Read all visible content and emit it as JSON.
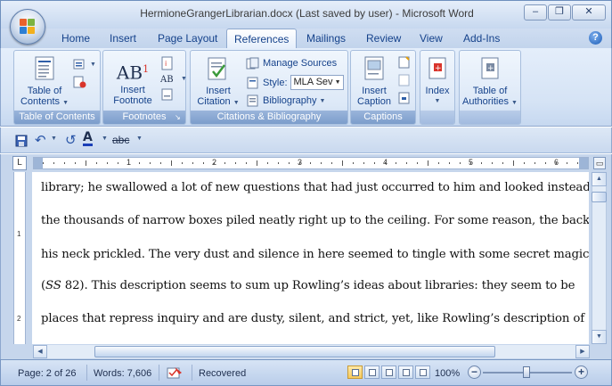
{
  "window": {
    "title": "HermioneGrangerLibrarian.docx (Last saved by user) - Microsoft Word",
    "controls": [
      "–",
      "❐",
      "✕"
    ]
  },
  "tabs": [
    {
      "label": "Home"
    },
    {
      "label": "Insert"
    },
    {
      "label": "Page Layout"
    },
    {
      "label": "References",
      "active": true
    },
    {
      "label": "Mailings"
    },
    {
      "label": "Review"
    },
    {
      "label": "View"
    },
    {
      "label": "Add-Ins"
    }
  ],
  "ribbon": {
    "toc_group": {
      "label": "Table of Contents",
      "button": [
        "Table of",
        "Contents"
      ]
    },
    "footnotes_group": {
      "label": "Footnotes",
      "button": [
        "Insert",
        "Footnote"
      ],
      "icon_text": "AB",
      "icon_sup": "1"
    },
    "citations_group": {
      "label": "Citations & Bibliography",
      "insert_citation": [
        "Insert",
        "Citation"
      ],
      "manage_sources": "Manage Sources",
      "style_label": "Style:",
      "style_value": "MLA Sev",
      "bibliography": "Bibliography"
    },
    "captions_group": {
      "label": "Captions",
      "button": [
        "Insert",
        "Caption"
      ]
    },
    "index_group": {
      "button": "Index"
    },
    "authorities_group": {
      "button": [
        "Table of",
        "Authorities"
      ]
    }
  },
  "qat": {
    "strike_label": "abc"
  },
  "ruler": {
    "numbers": [
      "1",
      "2",
      "3",
      "4",
      "5",
      "6"
    ]
  },
  "vruler": {
    "numbers": [
      "1",
      "2"
    ]
  },
  "document": {
    "lines": [
      "library; he swallowed a lot of new questions that had just occurred to him and looked instead at",
      "the thousands of narrow boxes piled neatly right up to the ceiling.  For some reason, the back of",
      "his neck prickled. The very dust and silence in here seemed to tingle with some secret magic”",
      "(SS 82).  This description seems to sum up Rowling’s ideas about libraries:  they seem to be",
      "places that repress inquiry and are dusty, silent, and strict, yet, like Rowling’s description of"
    ]
  },
  "status": {
    "page": "Page: 2 of 26",
    "words": "Words: 7,606",
    "recording": "Recovered",
    "zoom": "100%",
    "zoom_minus": "−",
    "zoom_plus": "+"
  },
  "colors": {
    "ribbon_text": "#15428b",
    "group_label_bg": "#7c9dcb",
    "active_view": "#f7c95b"
  },
  "icons": [
    "office-logo-icon",
    "save-icon",
    "undo-icon",
    "redo-icon",
    "font-color-icon",
    "strikethrough-icon",
    "help-icon",
    "spelling-icon"
  ]
}
